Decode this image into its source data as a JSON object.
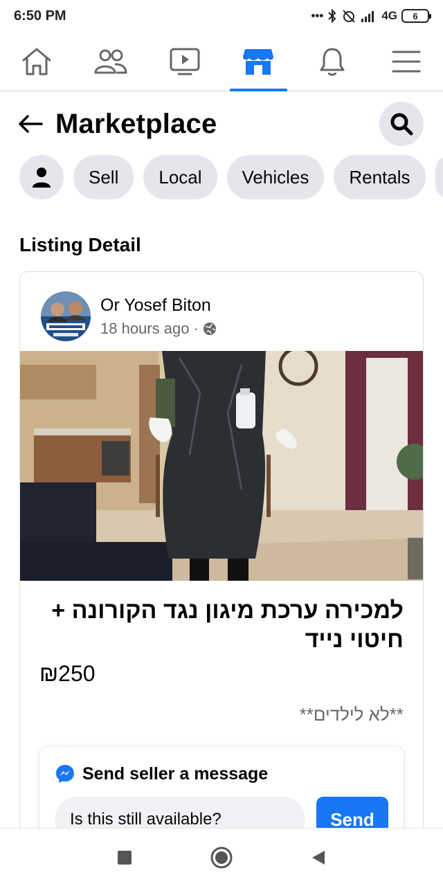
{
  "status_bar": {
    "time": "6:50 PM",
    "network": "4G",
    "battery": "6"
  },
  "top_nav": {
    "tabs": [
      {
        "icon": "home-icon",
        "active": false
      },
      {
        "icon": "friends-icon",
        "active": false
      },
      {
        "icon": "watch-icon",
        "active": false
      },
      {
        "icon": "marketplace-icon",
        "active": true
      },
      {
        "icon": "bell-icon",
        "active": false
      },
      {
        "icon": "menu-icon",
        "active": false
      }
    ],
    "accent_color": "#1877f2"
  },
  "header": {
    "title": "Marketplace"
  },
  "chips": {
    "sell": "Sell",
    "local": "Local",
    "vehicles": "Vehicles",
    "rentals": "Rentals"
  },
  "section_heading": "Listing Detail",
  "listing": {
    "seller_name": "Or Yosef Biton",
    "posted": "18 hours ago ·",
    "title": "למכירה ערכת מיגון נגד הקורונה + חיטוי נייד",
    "price": "₪250",
    "description": "**לא לילדים**",
    "message": {
      "heading": "Send seller a message",
      "input_value": "Is this still available?",
      "send_label": "Send"
    }
  }
}
